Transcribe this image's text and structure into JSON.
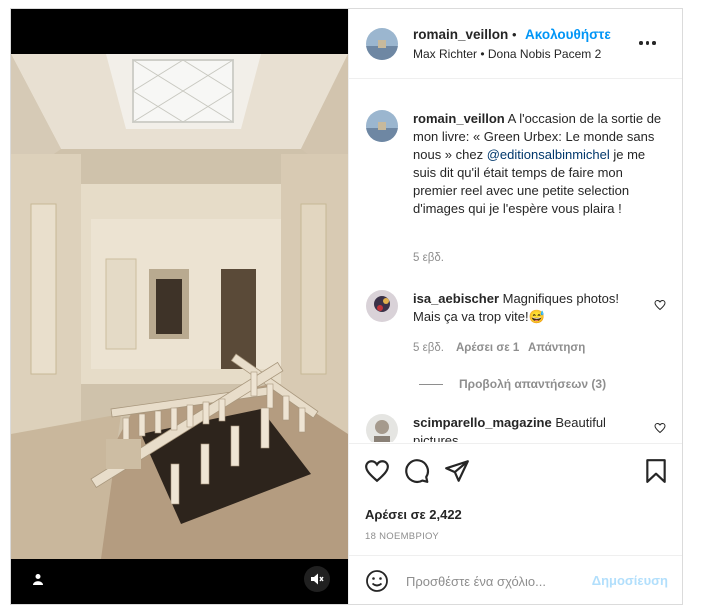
{
  "media": {
    "tag_icon": "user-tag-icon",
    "mute_icon": "speaker-muted-icon"
  },
  "header": {
    "username": "romain_veillon",
    "separator": "•",
    "follow_label": "Ακολουθήστε",
    "audio": "Max Richter • Dona Nobis Pacem 2",
    "more_icon": "more-options-icon"
  },
  "caption": {
    "username": "romain_veillon",
    "text_before": " A l'occasion de la sortie de mon livre: « Green Urbex: Le monde sans nous » chez ",
    "mention": "@editionsalbinmichel",
    "text_after": " je me suis dit qu'il était temps de faire mon premier reel avec une petite selection d'images qui je l'espère vous plaira !",
    "age": "5 εβδ."
  },
  "comments": [
    {
      "username": "isa_aebischer",
      "text": " Magnifiques photos! Mais ça va trop vite!😅",
      "age": "5 εβδ.",
      "likes": "Αρέσει σε 1",
      "reply": "Απάντηση",
      "view_replies": "Προβολή απαντήσεων (3)"
    },
    {
      "username": "scimparello_magazine",
      "text": " Beautiful pictures"
    }
  ],
  "actions": {
    "like_icon": "heart-icon",
    "comment_icon": "comment-icon",
    "share_icon": "share-icon",
    "save_icon": "bookmark-icon",
    "likes": "Αρέσει σε 2,422",
    "date": "18 ΝΟΕΜΒΡΙΟΥ"
  },
  "add_comment": {
    "emoji_icon": "emoji-icon",
    "placeholder": "Προσθέστε ένα σχόλιο...",
    "post_label": "Δημοσίευση"
  },
  "colors": {
    "accent": "#0095f6",
    "post_disabled": "#b2dffc",
    "muted_text": "#8e8e8e"
  }
}
